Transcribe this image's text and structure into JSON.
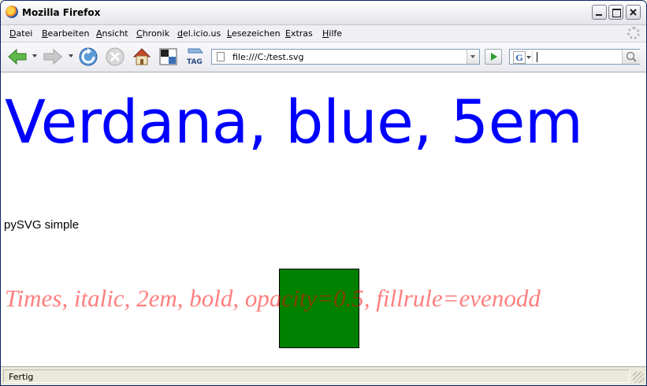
{
  "window": {
    "title": "Mozilla Firefox"
  },
  "menubar": {
    "items": [
      "Datei",
      "Bearbeiten",
      "Ansicht",
      "Chronik",
      "del.icio.us",
      "Lesezeichen",
      "Extras",
      "Hilfe"
    ]
  },
  "toolbar": {
    "back_icon": "back-arrow-icon",
    "forward_icon": "forward-arrow-icon",
    "reload_icon": "reload-icon",
    "stop_icon": "stop-icon",
    "home_icon": "home-icon",
    "tag_label": "TAG"
  },
  "urlbar": {
    "value": "file:///C:/test.svg"
  },
  "searchbar": {
    "engine_letter": "G",
    "value": ""
  },
  "content": {
    "line1": "Verdana, blue, 5em",
    "line2": "pySVG simple",
    "line3": "Times, italic, 2em, bold, opacity=0.5, fillrule=evenodd",
    "colors": {
      "line1": "#0000ff",
      "line3": "#ff0000",
      "rect_fill": "#008000"
    }
  },
  "statusbar": {
    "text": "Fertig"
  }
}
